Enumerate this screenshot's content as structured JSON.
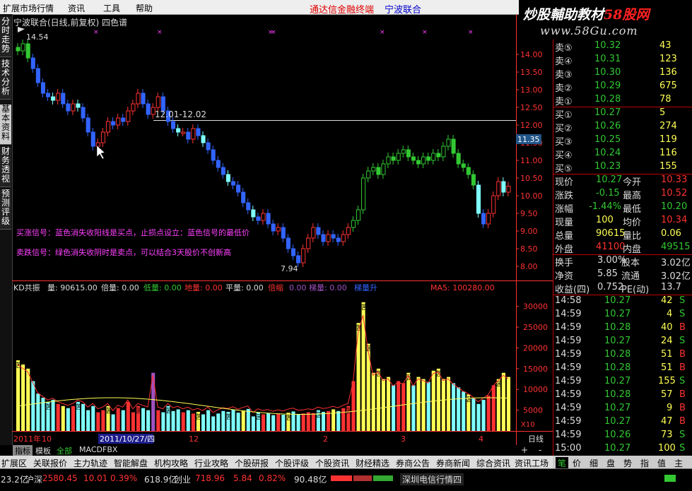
{
  "menu": {
    "items": [
      "扩展市场行情",
      "资讯",
      "工具",
      "帮助"
    ],
    "brand_left": "通达信金融终端",
    "brand_right": "宁波联合"
  },
  "logo": {
    "line1_a": "炒股輔助教材",
    "line1_b": "58股网",
    "line2": "www.58Gu.com"
  },
  "left_tabs": [
    "分时走势",
    "技术分析",
    "基本资料",
    "财务透视",
    "预测评级"
  ],
  "chart": {
    "title": "宁波联合(日线,前复权) 四色谱",
    "high_label": "14.54",
    "low_label": "7.94",
    "ref_label": "12.01-12.02",
    "current_price_tag": "11.35",
    "buy_signal_text": "买涨信号：蓝色消失收阳线是买点，止损点设立：蓝色信号的最低价",
    "sell_signal_text": "卖跌信号：绿色消失收阴时是卖点，可以结合3天股价不创新高",
    "indicator_line": {
      "name": "KD共振",
      "vol": "量: 90615.00",
      "bei": "倍量: 0.00",
      "di": "低量: 0.00",
      "di2": "地量: 0.00",
      "ping": "平量: 0.00",
      "beisuo": "倍缩",
      "suo": "0.00",
      "tiliang": "梯量: 0.00",
      "tiliangup": "梯量升",
      "ma5": "MA5: 100280.00"
    },
    "date_labels": [
      "2011年",
      "10",
      "11",
      "12",
      "2",
      "3",
      "4"
    ],
    "cursor_date": "2011/10/27/四",
    "period": "日线",
    "x10": "X10",
    "vol_marker": "苦",
    "colors": {
      "up": "#ff3232",
      "down": "#3264ff",
      "green": "#32c832",
      "cyan": "#7fffff",
      "yellow": "#ffff55",
      "purple": "#a050c0",
      "axis": "#ff3232",
      "signal": "#ff40ff"
    }
  },
  "chart_data": {
    "type": "candlestick",
    "title": "宁波联合(日线,前复权) 四色谱",
    "price_axis_ticks": [
      "14.00",
      "13.50",
      "13.00",
      "12.50",
      "12.00",
      "11.50",
      "11.00",
      "10.50",
      "10.00",
      "9.50",
      "9.00",
      "8.50",
      "8.00"
    ],
    "volume_axis_ticks": [
      "30000",
      "25000",
      "20000",
      "15000",
      "10000",
      "5000"
    ],
    "ylim": [
      7.7,
      14.7
    ],
    "volume_ylim": [
      0,
      33000
    ],
    "closes": [
      14.1,
      14.3,
      13.9,
      13.6,
      13.2,
      12.9,
      12.8,
      12.7,
      12.9,
      12.6,
      12.4,
      12.6,
      12.5,
      12.2,
      11.8,
      11.4,
      11.5,
      11.8,
      12.1,
      12.0,
      12.2,
      12.1,
      12.4,
      12.6,
      12.9,
      12.6,
      12.3,
      12.5,
      12.8,
      12.4,
      12.1,
      11.9,
      11.8,
      11.8,
      11.6,
      11.9,
      11.7,
      11.5,
      11.3,
      11.0,
      10.8,
      10.6,
      10.4,
      10.3,
      10.1,
      9.8,
      9.6,
      9.4,
      9.3,
      9.5,
      9.2,
      9.0,
      9.1,
      8.8,
      8.5,
      8.3,
      8.1,
      8.5,
      8.8,
      9.1,
      8.9,
      8.7,
      8.9,
      8.8,
      8.7,
      8.9,
      9.1,
      9.3,
      9.6,
      10.5,
      10.7,
      10.8,
      10.6,
      10.9,
      11.1,
      11.0,
      11.2,
      11.3,
      11.1,
      11.0,
      10.9,
      11.1,
      11.0,
      11.2,
      11.1,
      11.4,
      11.6,
      11.2,
      10.9,
      10.8,
      10.6,
      10.3,
      9.5,
      9.2,
      9.5,
      10.0,
      10.4,
      10.1,
      10.27
    ],
    "volumes": [
      17000,
      16000,
      15000,
      12000,
      9000,
      8000,
      7000,
      7500,
      6500,
      6000,
      5500,
      6000,
      7000,
      6500,
      5000,
      6000,
      4500,
      5000,
      6000,
      4000,
      5500,
      5000,
      7000,
      4500,
      6000,
      5500,
      5000,
      14000,
      5000,
      4500,
      6000,
      4800,
      5200,
      4500,
      5000,
      4200,
      4600,
      4000,
      5000,
      3500,
      4200,
      4800,
      4600,
      5100,
      4400,
      4900,
      5300,
      3500,
      4500,
      4000,
      4300,
      3800,
      4200,
      3900,
      4400,
      4700,
      4100,
      4200,
      4500,
      4300,
      5000,
      4600,
      4800,
      5200,
      4800,
      5500,
      6000,
      12000,
      26000,
      31000,
      21000,
      14000,
      15000,
      12500,
      13000,
      11000,
      12000,
      11500,
      14000,
      11000,
      13000,
      12500,
      11800,
      14500,
      15000,
      12500,
      13000,
      11500,
      10500,
      9500,
      8800,
      7800,
      6500,
      7500,
      8500,
      11000,
      12500,
      14000,
      13000
    ],
    "ma_price_tick": "12.01-12.02"
  },
  "quote": {
    "sell": [
      {
        "label": "卖⑤",
        "price": "10.32",
        "vol": "43"
      },
      {
        "label": "卖④",
        "price": "10.31",
        "vol": "123"
      },
      {
        "label": "卖③",
        "price": "10.30",
        "vol": "136"
      },
      {
        "label": "卖②",
        "price": "10.29",
        "vol": "675"
      },
      {
        "label": "卖①",
        "price": "10.28",
        "vol": "78"
      }
    ],
    "buy": [
      {
        "label": "买①",
        "price": "10.27",
        "vol": "5"
      },
      {
        "label": "买②",
        "price": "10.26",
        "vol": "274"
      },
      {
        "label": "买③",
        "price": "10.25",
        "vol": "119"
      },
      {
        "label": "买④",
        "price": "10.24",
        "vol": "116"
      },
      {
        "label": "买⑤",
        "price": "10.23",
        "vol": "155"
      }
    ],
    "stats": [
      {
        "l1": "现价",
        "v1": "10.27",
        "l2": "今开",
        "v2": "10.33"
      },
      {
        "l1": "涨跌",
        "v1": "-0.15",
        "l2": "最高",
        "v2": "10.52"
      },
      {
        "l1": "涨幅",
        "v1": "-1.44%",
        "l2": "最低",
        "v2": "10.20"
      },
      {
        "l1": "现量",
        "v1": "100",
        "l2": "均价",
        "v2": "10.34"
      },
      {
        "l1": "总量",
        "v1": "90615",
        "l2": "量比",
        "v2": "0.06"
      },
      {
        "l1": "外盘",
        "v1": "41100",
        "l2": "内盘",
        "v2": "49515"
      }
    ],
    "stats2": [
      {
        "l1": "换手",
        "v1": "3.00%",
        "l2": "股本",
        "v2": "3.02亿"
      },
      {
        "l1": "净资",
        "v1": "5.85",
        "l2": "流通",
        "v2": "3.02亿"
      },
      {
        "l1": "收益(四)",
        "v1": "0.752",
        "l2": "PE(动)",
        "v2": "13.7"
      }
    ],
    "ticks": [
      {
        "t": "14:58",
        "p": "10.27",
        "v": "42",
        "s": "S"
      },
      {
        "t": "14:59",
        "p": "10.27",
        "v": "4",
        "s": "S"
      },
      {
        "t": "14:59",
        "p": "10.28",
        "v": "40",
        "s": "B"
      },
      {
        "t": "14:59",
        "p": "10.27",
        "v": "24",
        "s": "S"
      },
      {
        "t": "14:59",
        "p": "10.28",
        "v": "51",
        "s": "B"
      },
      {
        "t": "14:59",
        "p": "10.28",
        "v": "51",
        "s": "B"
      },
      {
        "t": "14:59",
        "p": "10.27",
        "v": "155",
        "s": "S"
      },
      {
        "t": "14:59",
        "p": "10.28",
        "v": "57",
        "s": "B"
      },
      {
        "t": "14:59",
        "p": "10.27",
        "v": "9",
        "s": "B"
      },
      {
        "t": "14:59",
        "p": "10.27",
        "v": "47",
        "s": "B"
      },
      {
        "t": "14:59",
        "p": "10.26",
        "v": "73",
        "s": "S"
      },
      {
        "t": "15:00",
        "p": "10.27",
        "v": "100",
        "s": "S"
      }
    ],
    "side_tabs": [
      "笔",
      "价",
      "细",
      "盘",
      "势",
      "指",
      "值",
      "主"
    ]
  },
  "bottom_tabs": [
    "指标",
    "模板",
    "全部",
    "MACD",
    "FBX"
  ],
  "bottom_bar": [
    "扩展区",
    "关联报价",
    "主力轨迹",
    "智能解盘",
    "机构攻略",
    "行业攻略",
    "个股研报",
    "个股评级",
    "个股资讯",
    "财经精选",
    "券商公告",
    "券商新闻",
    "综合资讯",
    "资讯工场"
  ],
  "status": {
    "a": "23.2亿",
    "sh_label": "沪深",
    "sh_val": "2580.45",
    "sh_chg": "10.01",
    "sh_pct": "0.39%",
    "sh_amt": "618.9亿",
    "cy_label": "创业",
    "cy_val": "718.96",
    "cy_chg": "5.84",
    "cy_pct": "0.82%",
    "cy_amt": "90.48亿",
    "feed": "深圳电信行情四"
  },
  "controls": {
    "plus": "+",
    "minus": "-"
  }
}
